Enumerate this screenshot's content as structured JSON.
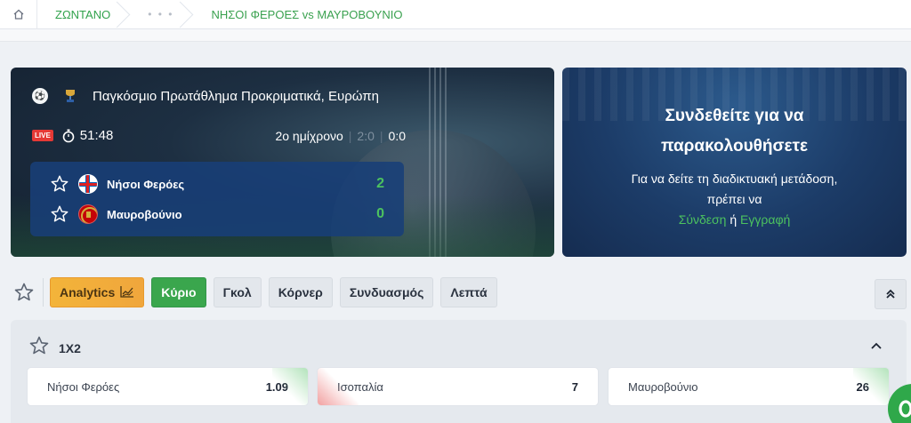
{
  "breadcrumb": {
    "home_icon": "home-icon",
    "live": "ΖΩΝΤΑΝΟ",
    "dots": "• • •",
    "match": "ΝΗΣΟΙ ΦΕΡΟΕΣ vs ΜΑΥΡΟΒΟΥΝΙΟ"
  },
  "scoreboard": {
    "league": "Παγκόσμιο Πρωτάθλημα Προκριματικά, Ευρώπη",
    "live_badge": "LIVE",
    "clock": "51:48",
    "period": "2ο ημίχρονο",
    "halftime_score": "2:0",
    "current_score": "0:0",
    "teams": [
      {
        "name": "Νήσοι Φερόες",
        "score": "2"
      },
      {
        "name": "Μαυροβούνιο",
        "score": "0"
      }
    ]
  },
  "promo": {
    "title": "Συνδεθείτε για να παρακολουθήσετε",
    "text": "Για να δείτε τη διαδικτυακή μετάδοση, πρέπει να",
    "login": "Σύνδεση",
    "or": "ή",
    "register": "Εγγραφή"
  },
  "tabs": {
    "analytics": "Analytics",
    "items": [
      "Κύριο",
      "Γκολ",
      "Κόρνερ",
      "Συνδυασμός",
      "Λεπτά"
    ]
  },
  "market": {
    "title": "1X2",
    "odds": [
      {
        "label": "Νήσοι Φερόες",
        "value": "1.09",
        "trend": "up"
      },
      {
        "label": "Ισοπαλία",
        "value": "7",
        "trend": "down"
      },
      {
        "label": "Μαυροβούνιο",
        "value": "26",
        "trend": "up"
      }
    ]
  },
  "colors": {
    "accent_green": "#3aa64d",
    "live_red": "#e53935",
    "analytics_orange": "#f3b43a"
  }
}
